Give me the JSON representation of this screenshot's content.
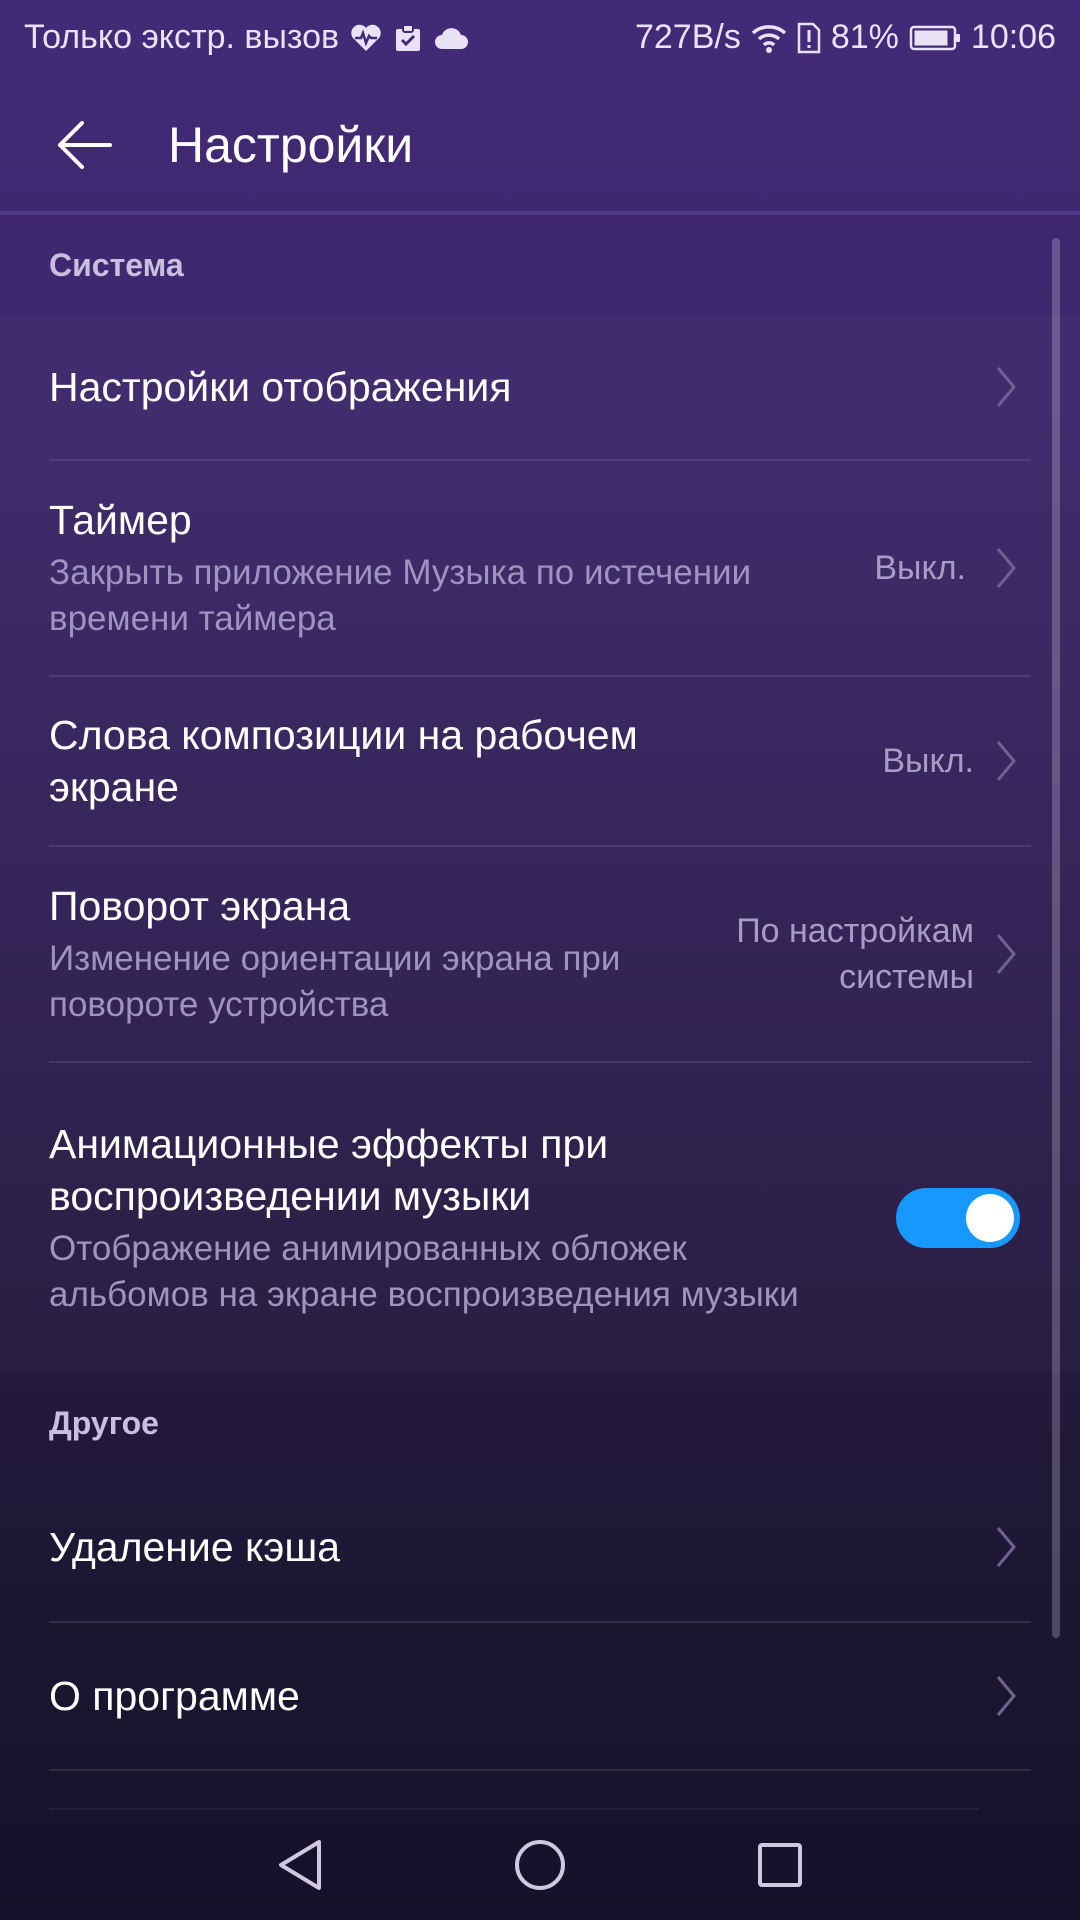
{
  "status_bar": {
    "left_text": "Только экстр. вызов",
    "left_icons": [
      "heart-pulse-icon",
      "clipboard-check-icon",
      "cloud-icon"
    ],
    "net_speed": "727B/s",
    "battery_percent": "81%",
    "time": "10:06",
    "right_icons": [
      "wifi-icon",
      "sim-alert-icon",
      "battery-icon"
    ]
  },
  "app_bar": {
    "title": "Настройки",
    "back_icon": "arrow-left-icon"
  },
  "sections": [
    {
      "header": "Система",
      "items": [
        {
          "title": "Настройки отображения",
          "subtitle": "",
          "value": "",
          "control": "chevron"
        },
        {
          "title": "Таймер",
          "subtitle": "Закрыть приложение Музыка по истечении времени таймера",
          "value": "Выкл.",
          "control": "chevron"
        },
        {
          "title": "Слова композиции на рабочем экране",
          "subtitle": "",
          "value": "Выкл.",
          "control": "chevron"
        },
        {
          "title": "Поворот экрана",
          "subtitle": "Изменение ориентации экрана при повороте устройства",
          "value": "По настройкам системы",
          "control": "chevron"
        },
        {
          "title": "Анимационные эффекты при воспроизведении музыки",
          "subtitle": "Отображение анимированных обложек альбомов на экране воспроизведения музыки",
          "value": "",
          "control": "toggle",
          "toggle_on": true
        }
      ]
    },
    {
      "header": "Другое",
      "items": [
        {
          "title": "Удаление кэша",
          "subtitle": "",
          "value": "",
          "control": "chevron"
        },
        {
          "title": "О программе",
          "subtitle": "",
          "value": "",
          "control": "chevron"
        }
      ]
    }
  ],
  "nav_bar": {
    "icons": [
      "back-triangle-icon",
      "home-circle-icon",
      "recents-square-icon"
    ]
  },
  "colors": {
    "accent": "#1698ff",
    "background_top": "#432a78",
    "background_bottom": "#15112a",
    "secondary_text": "#9f93bf"
  }
}
